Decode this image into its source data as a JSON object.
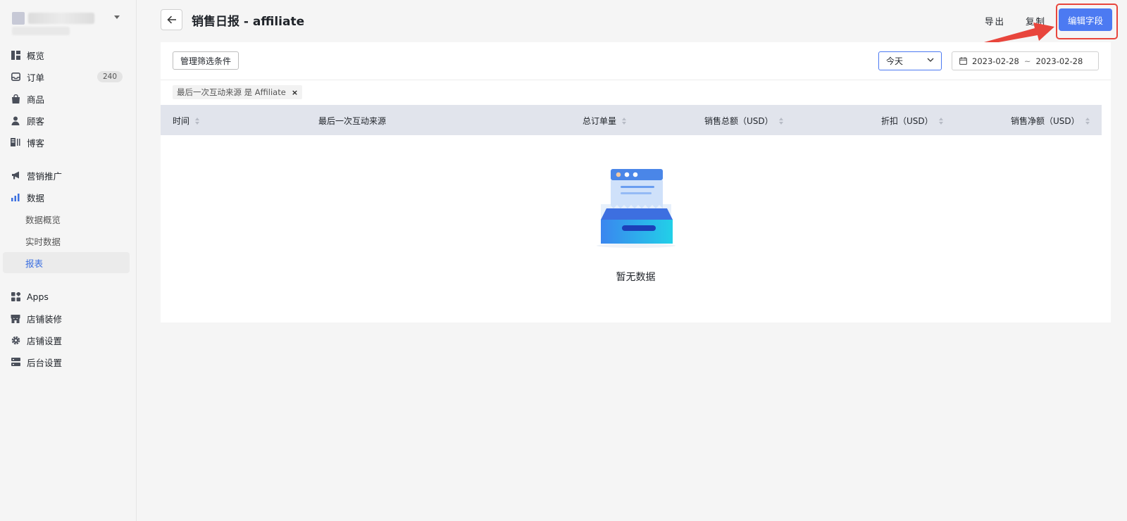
{
  "sidebar": {
    "items": [
      {
        "label": "概览",
        "icon": "dashboard-icon"
      },
      {
        "label": "订单",
        "icon": "inbox-icon",
        "badge": "240"
      },
      {
        "label": "商品",
        "icon": "bag-icon"
      },
      {
        "label": "顾客",
        "icon": "user-icon"
      },
      {
        "label": "博客",
        "icon": "blog-icon"
      },
      {
        "label": "营销推广",
        "icon": "megaphone-icon"
      },
      {
        "label": "数据",
        "icon": "bar-chart-icon"
      },
      {
        "label": "数据概览"
      },
      {
        "label": "实时数据"
      },
      {
        "label": "报表",
        "active": true
      },
      {
        "label": "Apps",
        "icon": "apps-icon"
      },
      {
        "label": "店铺装修",
        "icon": "storefront-icon"
      },
      {
        "label": "店铺设置",
        "icon": "gear-icon"
      },
      {
        "label": "后台设置",
        "icon": "server-icon"
      }
    ]
  },
  "header": {
    "title": "销售日报 - affiliate",
    "export_label": "导出",
    "copy_label": "复制",
    "edit_fields_label": "编辑字段"
  },
  "filters": {
    "manage_label": "管理筛选条件",
    "period": "今天",
    "date_start": "2023-02-28",
    "date_sep": "~",
    "date_end": "2023-02-28",
    "tag_label": "最后一次互动来源 是 Affiliate",
    "tag_close": "×"
  },
  "table": {
    "columns": [
      "时间",
      "最后一次互动来源",
      "总订单量",
      "销售总额（USD）",
      "折扣（USD）",
      "销售净额（USD）"
    ],
    "rows": []
  },
  "empty": {
    "text": "暂无数据"
  },
  "colors": {
    "primary": "#4c7af2",
    "annotation": "#e8453c",
    "table_header_bg": "#e1e4ec",
    "active_nav": "#3b6fe0"
  }
}
